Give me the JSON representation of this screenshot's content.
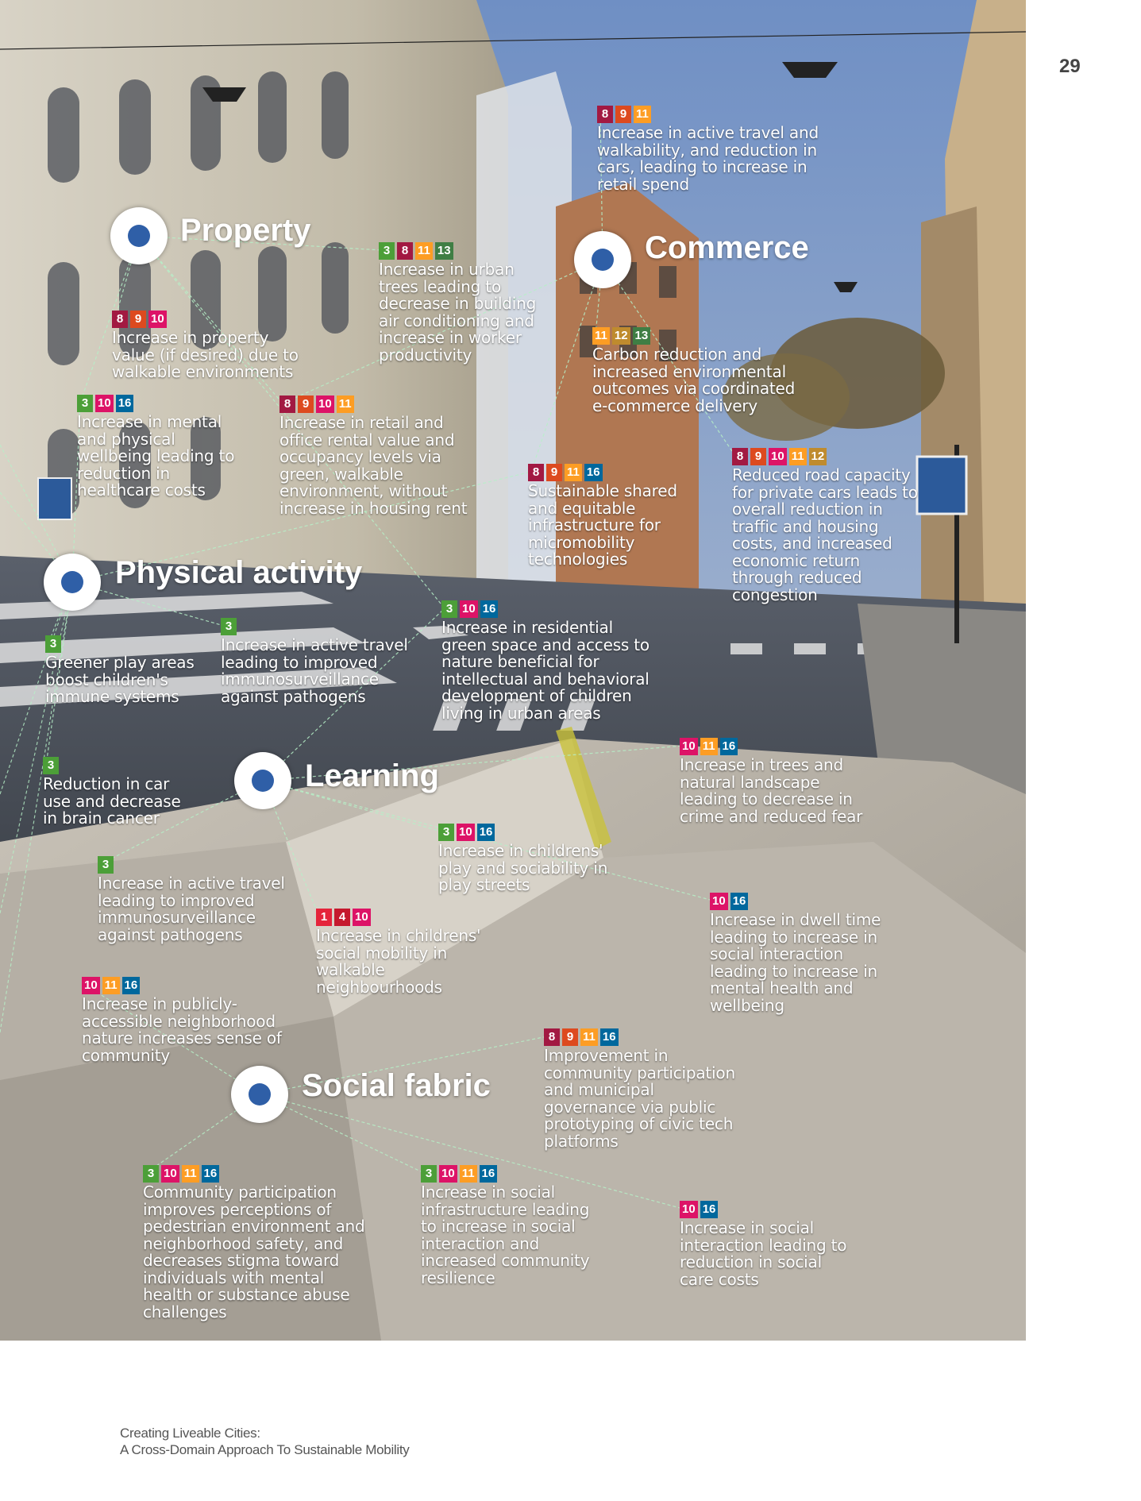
{
  "page_number": "29",
  "footer": {
    "line1": "Creating Liveable Cities:",
    "line2": "A Cross-Domain Approach To Sustainable Mobility"
  },
  "colors": {
    "sdg": {
      "1": "#e5243b",
      "3": "#4c9f38",
      "4": "#c5192d",
      "8": "#a21942",
      "9": "#dd4a1f",
      "10": "#dd1367",
      "11": "#fd9d24",
      "12": "#bf8b2e",
      "13": "#3f7e44",
      "16": "#00689d"
    },
    "node_dot": "#2f5fa7"
  },
  "categories": [
    {
      "name": "Property",
      "node": "blue-dot"
    },
    {
      "name": "Commerce",
      "node": "blue-dot"
    },
    {
      "name": "Physical activity",
      "node": "blue-dot"
    },
    {
      "name": "Learning",
      "node": "blue-dot"
    },
    {
      "name": "Social fabric",
      "node": "blue-dot"
    }
  ],
  "items": [
    {
      "sdgs": [
        "8",
        "9",
        "11"
      ],
      "text": "Increase in active travel and\nwalkability, and reduction in\ncars, leading to increase in\nretail spend"
    },
    {
      "sdgs": [
        "3",
        "8",
        "11",
        "13"
      ],
      "text": "Increase in urban\ntrees leading to\ndecrease in building\nair conditioning and\nincrease in worker\nproductivity"
    },
    {
      "sdgs": [
        "8",
        "9",
        "10"
      ],
      "text": "Increase in property\nvalue (if desired) due to\nwalkable environments"
    },
    {
      "sdgs": [
        "11",
        "12",
        "13"
      ],
      "text": "Carbon reduction and\nincreased environmental\noutcomes via coordinated\ne-commerce delivery"
    },
    {
      "sdgs": [
        "3",
        "10",
        "16"
      ],
      "text": "Increase in mental\nand physical\nwellbeing leading to\nreduction in\nhealthcare costs"
    },
    {
      "sdgs": [
        "8",
        "9",
        "10",
        "11"
      ],
      "text": "Increase in retail and\noffice rental value and\noccupancy levels via\ngreen, walkable\nenvironment, without\nincrease in housing rent"
    },
    {
      "sdgs": [
        "8",
        "9",
        "10",
        "11",
        "12"
      ],
      "text": "Reduced road capacity\nfor private cars leads to\noverall reduction in\ntraffic and housing\ncosts, and increased\neconomic return\nthrough reduced\ncongestion"
    },
    {
      "sdgs": [
        "8",
        "9",
        "11",
        "16"
      ],
      "text": "Sustainable shared\nand equitable\ninfrastructure for\nmicromobility\ntechnologies"
    },
    {
      "sdgs": [
        "3",
        "10",
        "16"
      ],
      "text": "Increase in residential\ngreen space and access to\nnature beneficial for\nintellectual and behavioral\ndevelopment of children\nliving in urban areas"
    },
    {
      "sdgs": [
        "3"
      ],
      "text": "Greener play areas\nboost children's\nimmune systems"
    },
    {
      "sdgs": [
        "3"
      ],
      "text": "Increase in active travel\nleading to improved\nimmunosurveillance\nagainst pathogens"
    },
    {
      "sdgs": [
        "10",
        "11",
        "16"
      ],
      "text": "Increase in trees and\nnatural landscape\nleading to decrease in\ncrime and reduced fear"
    },
    {
      "sdgs": [
        "3"
      ],
      "text": "Reduction in car\nuse and decrease\nin brain cancer"
    },
    {
      "sdgs": [
        "3",
        "10",
        "16"
      ],
      "text": "Increase in childrens'\nplay and sociability in\nplay streets"
    },
    {
      "sdgs": [
        "3"
      ],
      "text": "Increase in active travel\nleading to improved\nimmunosurveillance\nagainst pathogens"
    },
    {
      "sdgs": [
        "10",
        "16"
      ],
      "text": "Increase in dwell time\nleading to increase in\nsocial interaction\nleading to increase in\nmental health and\nwellbeing"
    },
    {
      "sdgs": [
        "1",
        "4",
        "10"
      ],
      "text": "Increase in childrens'\nsocial mobility in\nwalkable\nneighbourhoods"
    },
    {
      "sdgs": [
        "10",
        "11",
        "16"
      ],
      "text": "Increase in publicly-\naccessible neighborhood\nnature increases sense of\ncommunity"
    },
    {
      "sdgs": [
        "8",
        "9",
        "11",
        "16"
      ],
      "text": "Improvement in\ncommunity participation\nand municipal\ngovernance via public\nprototyping of civic tech\nplatforms"
    },
    {
      "sdgs": [
        "3",
        "10",
        "11",
        "16"
      ],
      "text": "Community participation\nimproves perceptions of\npedestrian environment and\nneighborhood safety, and\ndecreases stigma toward\nindividuals with mental\nhealth or substance abuse\nchallenges"
    },
    {
      "sdgs": [
        "3",
        "10",
        "11",
        "16"
      ],
      "text": "Increase in social\ninfrastructure leading\nto increase in social\ninteraction and\nincreased community\nresilience"
    },
    {
      "sdgs": [
        "10",
        "16"
      ],
      "text": "Increase in social\ninteraction leading to\nreduction in social\ncare costs"
    }
  ]
}
